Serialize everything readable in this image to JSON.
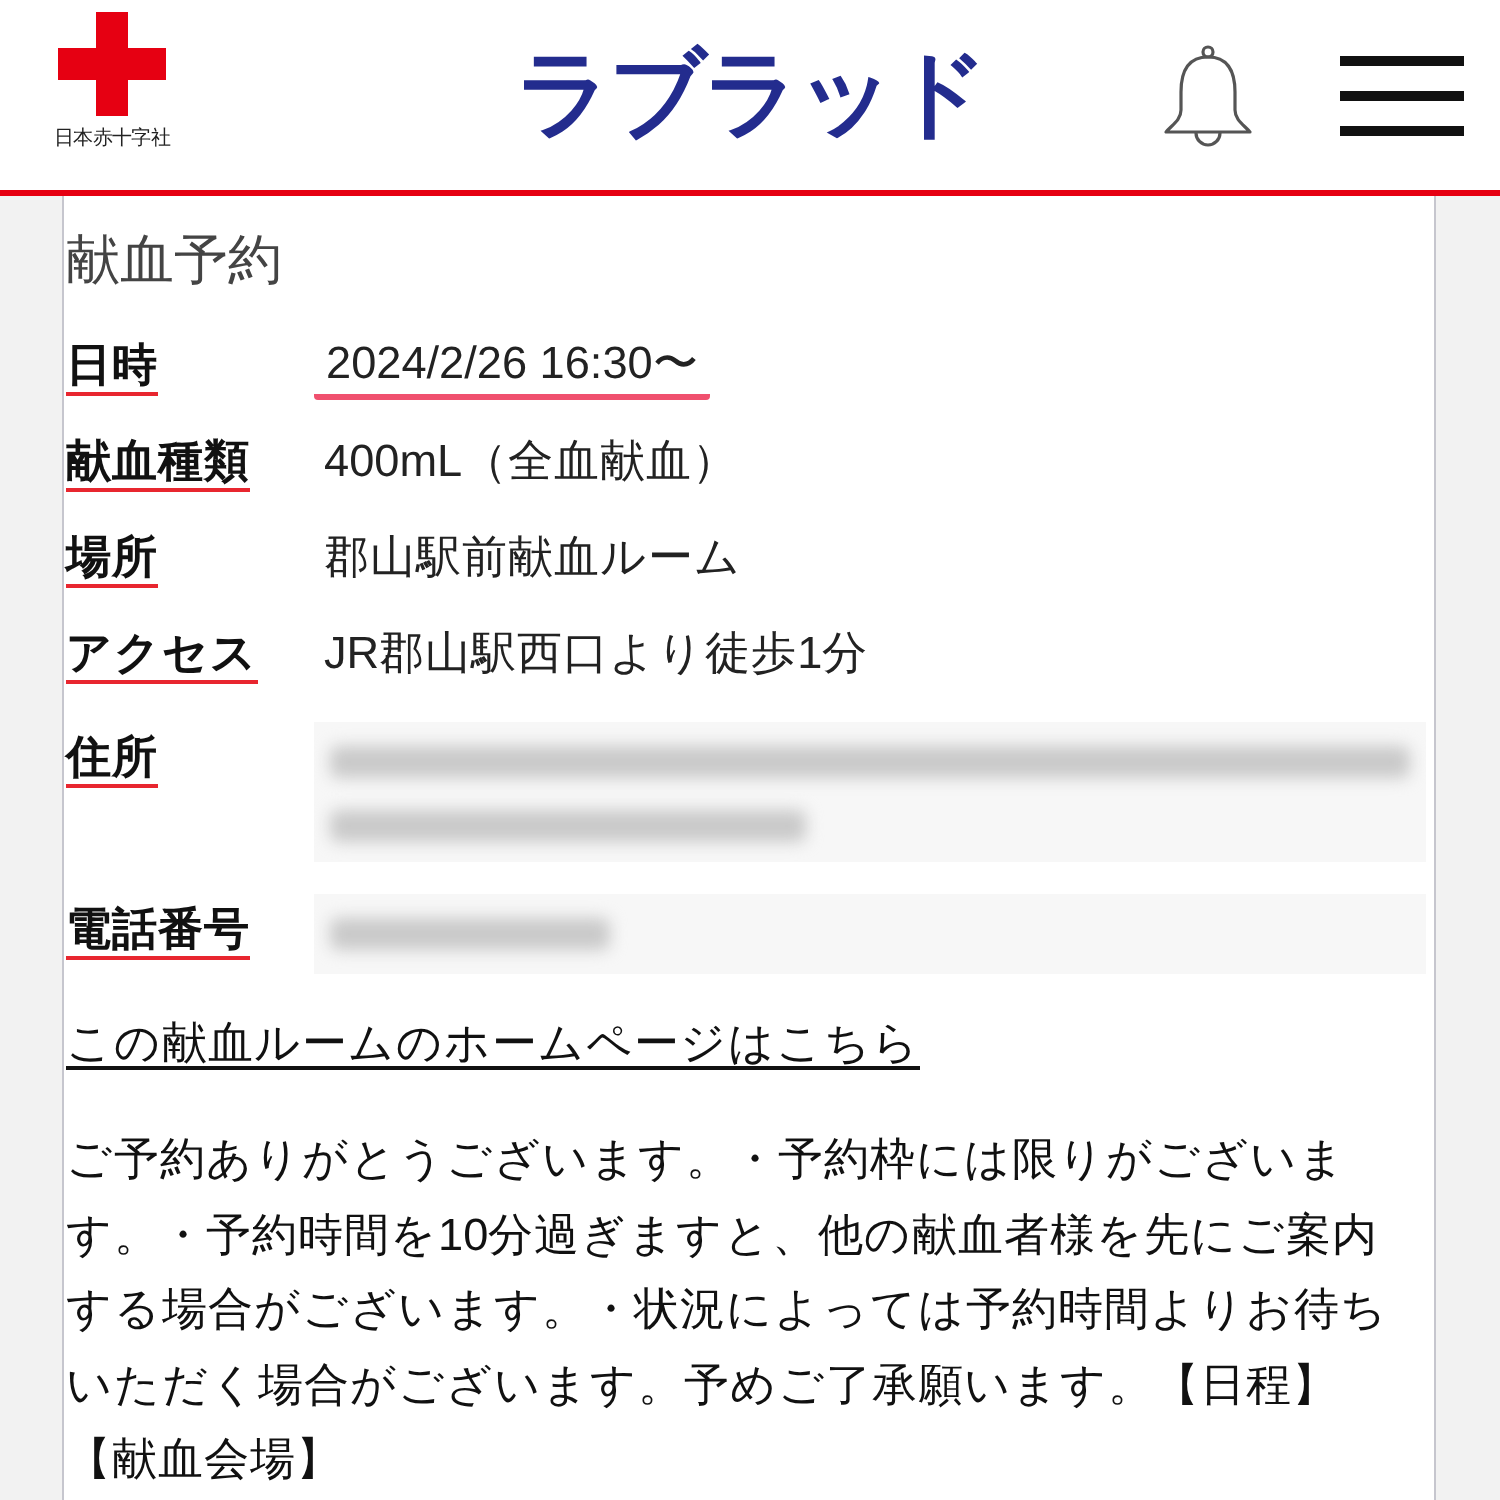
{
  "header": {
    "logo_caption": "日本赤十字社",
    "app_title": "ラブラッド"
  },
  "reservation": {
    "title": "献血予約",
    "rows": [
      {
        "label": "日時",
        "kind": "emphasis",
        "value": "2024/2/26 16:30〜"
      },
      {
        "label": "献血種類",
        "kind": "text",
        "value": "400mL（全血献血）"
      },
      {
        "label": "場所",
        "kind": "text",
        "value": "郡山駅前献血ルーム"
      },
      {
        "label": "アクセス",
        "kind": "text",
        "value": "JR郡山駅西口より徒歩1分"
      },
      {
        "label": "住所",
        "kind": "blur-long"
      },
      {
        "label": "電話番号",
        "kind": "blur-short"
      }
    ],
    "homepage_link": "この献血ルームのホームページはこちら",
    "notice": "ご予約ありがとうございます。・予約枠には限りがございます。・予約時間を10分過ぎますと、他の献血者様を先にご案内する場合がございます。・状況によっては予約時間よりお待ちいただく場合がございます。予めご了承願います。【日程】【献血会場】"
  }
}
